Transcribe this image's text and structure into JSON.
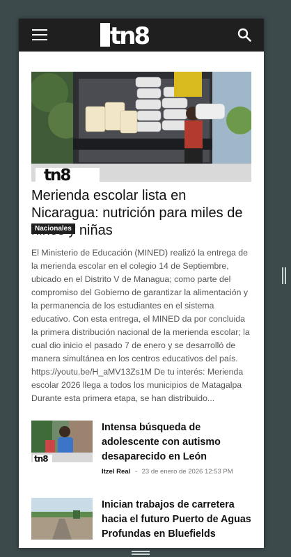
{
  "header": {
    "logo_text": "tn8",
    "menu_icon": "hamburger-menu-icon",
    "search_icon": "search-icon",
    "background_color": "#1f1f1f"
  },
  "featured": {
    "image_overlay_logo": "tn8",
    "headline": "Merienda escolar lista en Nicaragua: nutrición para miles de niños y niñas",
    "category": "Nacionales",
    "excerpt": "El Ministerio de Educación (MINED) realizó la entrega de la merienda escolar en el colegio 14 de Septiembre, ubicado en el Distrito V de Managua; como parte del compromiso del Gobierno de garantizar la alimentación y la permanencia de los estudiantes en el sistema educativo. Con esta entrega, el MINED da por concluida la primera distribución nacional de la merienda escolar; la cual dio inicio el pasado 7 de enero y se desarrolló de manera simultánea en los centros educativos del país. https://youtu.be/H_aMV13Zs1M De tu interés: Merienda escolar 2026 llega a todos los municipios de Matagalpa Durante esta primera etapa, se han distribuido..."
  },
  "articles": [
    {
      "title": "Intensa búsqueda de adolescente con autismo desaparecido en León",
      "author": "Itzel Real",
      "separator": "-",
      "date": "23 de enero de 2026 12:53 PM",
      "thumb_overlay": "tn8"
    },
    {
      "title": "Inician trabajos de carretera hacia el futuro Puerto de Aguas Profundas en Bluefields"
    }
  ]
}
